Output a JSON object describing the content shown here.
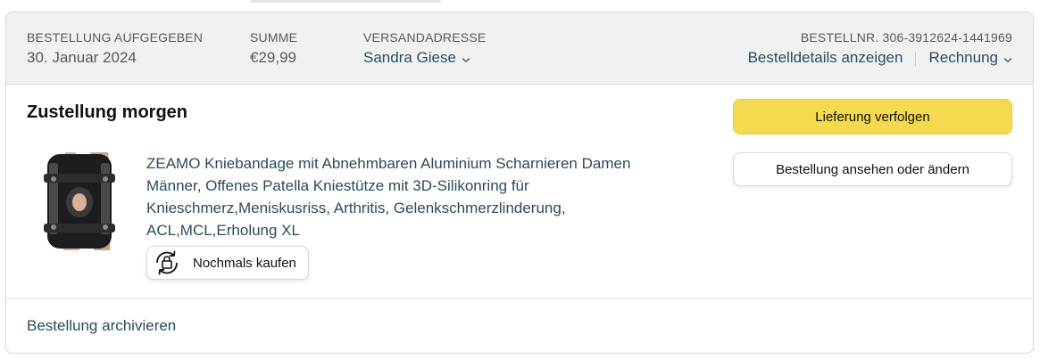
{
  "header": {
    "order_placed_label": "BESTELLUNG AUFGEGEBEN",
    "order_placed_value": "30. Januar 2024",
    "total_label": "SUMME",
    "total_value": "€29,99",
    "ship_to_label": "VERSANDADRESSE",
    "ship_to_value": "Sandra Giese",
    "order_number_label": "BESTELLNR. 306-3912624-1441969",
    "order_details_link": "Bestelldetails anzeigen",
    "invoice_link": "Rechnung"
  },
  "shipment": {
    "status": "Zustellung morgen",
    "product_title": "ZEAMO Kniebandage mit Abnehmbaren Aluminium Scharnieren Damen Männer, Offenes Patella Kniestütze mit 3D-Silikonring für Knieschmerz,Meniskusriss, Arthritis, Gelenkschmerzlinderung, ACL,MCL,Erholung XL",
    "buy_again_label": "Nochmals kaufen",
    "track_button": "Lieferung verfolgen",
    "view_edit_button": "Bestellung ansehen oder ändern"
  },
  "footer": {
    "archive_link": "Bestellung archivieren"
  },
  "icons": {
    "buy_again": "buy-again-icon",
    "chevron": "chevron-down-icon"
  },
  "colors": {
    "primary_button": "#f5d94e",
    "link": "#2f4a59",
    "header_bg": "#f0f2f2"
  }
}
